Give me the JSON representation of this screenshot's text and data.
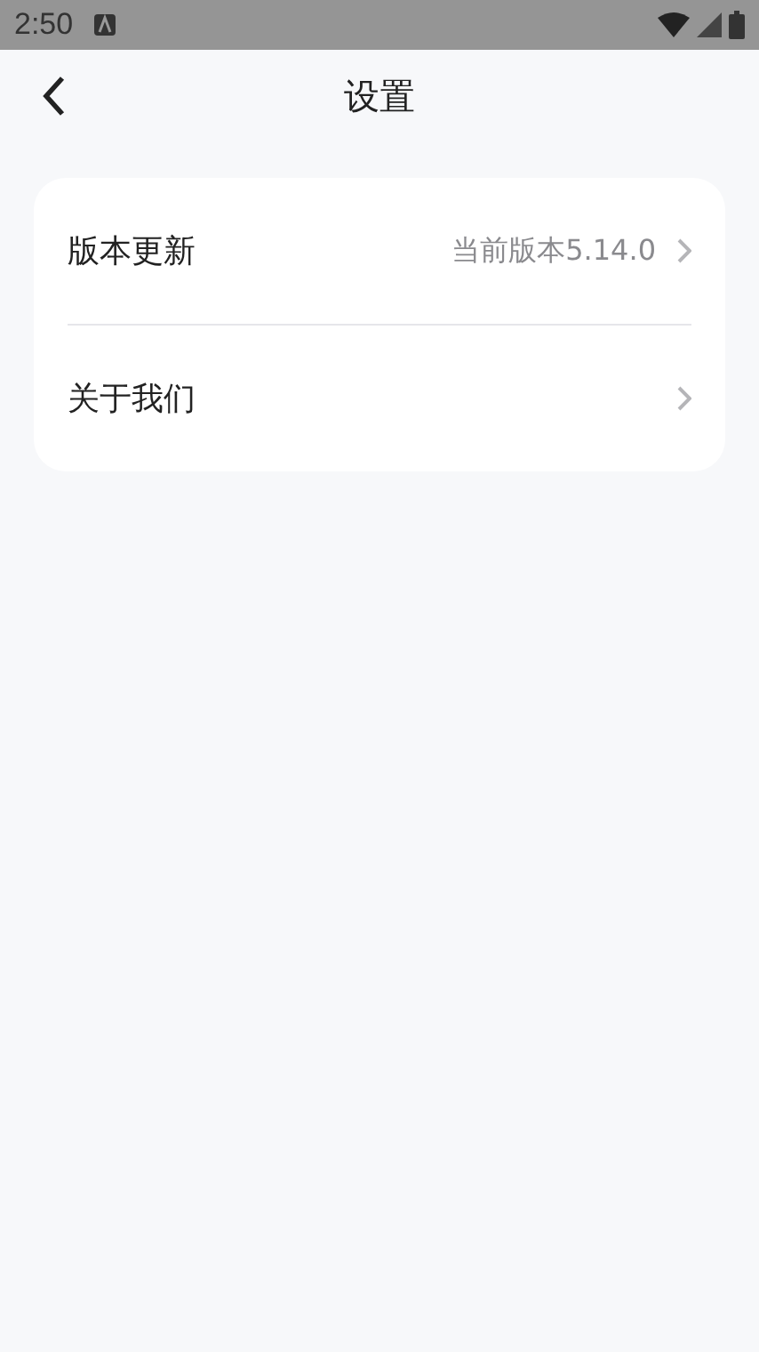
{
  "status_bar": {
    "time": "2:50"
  },
  "header": {
    "title": "设置"
  },
  "settings": [
    {
      "label": "版本更新",
      "value": "当前版本5.14.0"
    },
    {
      "label": "关于我们"
    }
  ]
}
